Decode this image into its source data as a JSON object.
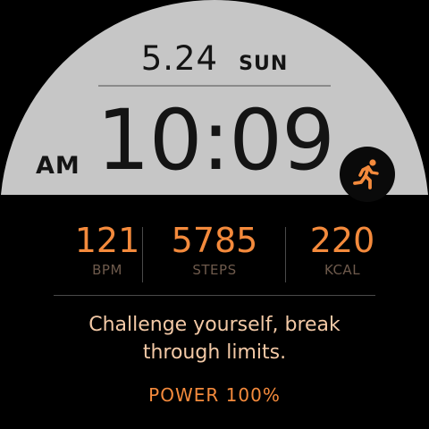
{
  "header": {
    "date": "5.24",
    "weekday": "SUN"
  },
  "clock": {
    "ampm": "AM",
    "time": "10:09"
  },
  "activity_icon": {
    "icon": "running-person-icon",
    "color": "#f48a3c"
  },
  "stats": [
    {
      "value": "121",
      "label": "BPM"
    },
    {
      "value": "5785",
      "label": "STEPS"
    },
    {
      "value": "220",
      "label": "KCAL"
    }
  ],
  "motto": {
    "line1": "Challenge yourself, break",
    "line2": "through limits."
  },
  "power": {
    "label": "POWER",
    "value": "100%"
  },
  "colors": {
    "background": "#000000",
    "dome": "#c6c6c6",
    "accent": "#f48a3c",
    "motto": "#f3c9a6",
    "stat_label": "#6e5a4c"
  }
}
